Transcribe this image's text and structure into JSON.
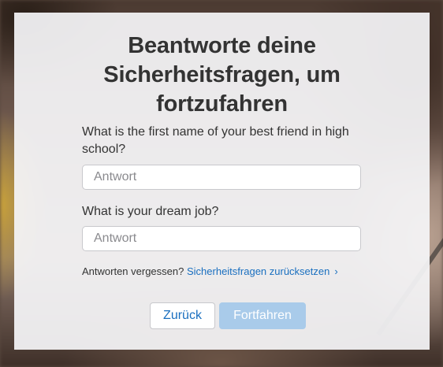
{
  "dialog": {
    "title_lines": [
      "Beantworte deine",
      "Sicherheitsfragen, um",
      "fortzufahren"
    ],
    "question1": {
      "label": "What is the first name of your best friend in high school?",
      "value": "",
      "placeholder": "Antwort"
    },
    "question2": {
      "label": "What is your dream job?",
      "value": "",
      "placeholder": "Antwort"
    },
    "forgot": {
      "text": "Antworten vergessen?",
      "link": "Sicherheitsfragen zurücksetzen",
      "chevron": "›"
    },
    "buttons": {
      "back": "Zurück",
      "continue": "Fortfahren"
    }
  },
  "colors": {
    "link": "#1a6fbf",
    "continue_disabled": "#a9cbea",
    "card_bg": "#f5f5f7"
  }
}
